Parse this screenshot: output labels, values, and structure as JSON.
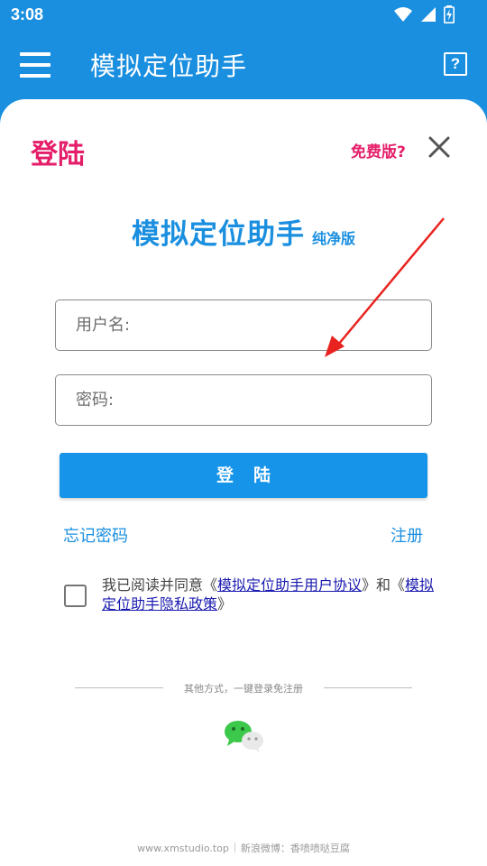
{
  "status": {
    "time": "3:08"
  },
  "appbar": {
    "title": "模拟定位助手",
    "menu_icon": "hamburger-menu-icon",
    "help_icon": "help-question-icon",
    "help_glyph": "?"
  },
  "login": {
    "title": "登陆",
    "free_link": "免费版?",
    "brand_name": "模拟定位助手",
    "brand_sub": "纯净版",
    "username_placeholder": "用户名:",
    "password_placeholder": "密码:",
    "login_button": "登陆",
    "forgot_password": "忘记密码",
    "register": "注册",
    "agreement": {
      "prefix": "我已阅读并同意《",
      "user_agreement": "模拟定位助手用户协议",
      "middle": "》和《",
      "privacy_policy": "模拟定位助手隐私政策",
      "suffix": "》"
    },
    "other_methods": "其他方式，一键登录免注册",
    "wechat_icon": "wechat-icon"
  },
  "footer": {
    "site": "www.xmstudio.top",
    "weibo": "新浪微博：香喷喷哒豆腐"
  },
  "colors": {
    "primary": "#1a8fe0",
    "button": "#1594ea",
    "accent": "#e51e6a",
    "arrow": "#e8231f",
    "wechat": "#3cc84a"
  }
}
